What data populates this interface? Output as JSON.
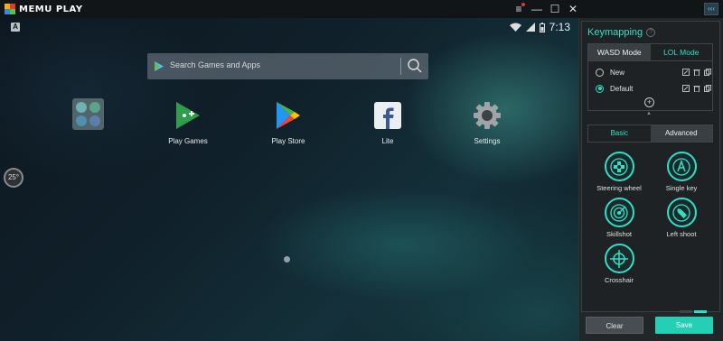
{
  "titlebar": {
    "app_name": "MEMU PLAY",
    "controls": {
      "menu": "≡",
      "minimize": "—",
      "maximize": "☐",
      "close": "✕"
    },
    "collapse_label": "‹‹‹"
  },
  "statusbar": {
    "notification": "A",
    "time": "7:13"
  },
  "search": {
    "placeholder": "Search Games and Apps"
  },
  "apps": [
    {
      "label": "Play Games"
    },
    {
      "label": "Play Store"
    },
    {
      "label": "Lite"
    },
    {
      "label": "Settings"
    }
  ],
  "rotation": {
    "label": "25°"
  },
  "keymapping": {
    "title": "Keymapping",
    "help": "?",
    "mode_tabs": [
      {
        "label": "WASD Mode"
      },
      {
        "label": "LOL Mode"
      }
    ],
    "schemes": [
      {
        "name": "New",
        "selected": false
      },
      {
        "name": "Default",
        "selected": true
      }
    ],
    "add_symbol": "+",
    "kind_tabs": [
      {
        "label": "Basic"
      },
      {
        "label": "Advanced"
      }
    ],
    "tools": [
      {
        "label": "Steering wheel"
      },
      {
        "label": "Single key"
      },
      {
        "label": "Skillshot"
      },
      {
        "label": "Left shoot"
      },
      {
        "label": "Crosshair"
      }
    ],
    "buttons": {
      "clear": "Clear",
      "save": "Save"
    }
  },
  "colors": {
    "accent": "#2ee0c8",
    "save_button": "#25cfb5",
    "panel_bg": "#222629",
    "close_badge": "#e5392d"
  }
}
